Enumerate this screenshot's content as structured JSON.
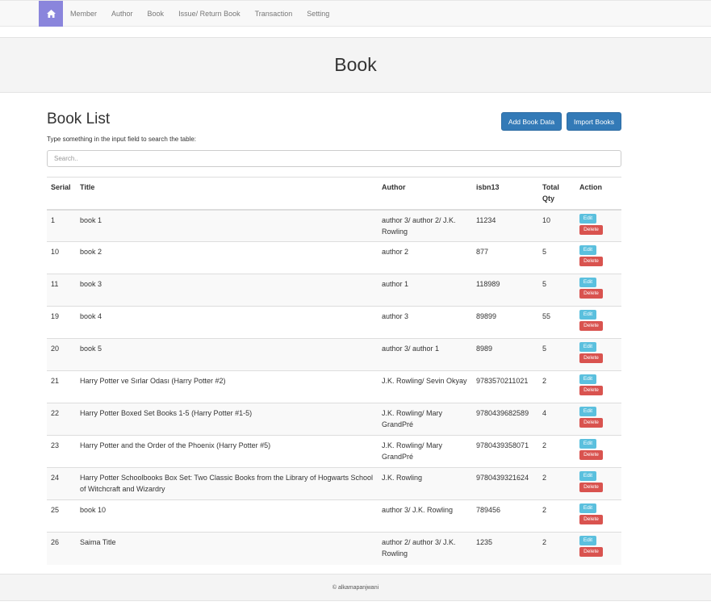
{
  "nav": {
    "home_icon": "home-icon",
    "items": [
      "Member",
      "Author",
      "Book",
      "Issue/ Return Book",
      "Transaction",
      "Setting"
    ]
  },
  "header": {
    "title": "Book"
  },
  "list": {
    "title": "Book List",
    "add_label": "Add Book Data",
    "import_label": "Import Books",
    "hint": "Type something in the input field to search the table:",
    "search_placeholder": "Search.."
  },
  "table": {
    "columns": [
      "Serial",
      "Title",
      "Author",
      "isbn13",
      "Total Qty",
      "Action"
    ],
    "edit_label": "Edit",
    "delete_label": "Delete",
    "rows": [
      {
        "serial": "1",
        "title": "book 1",
        "author": "author 3/ author 2/ J.K. Rowling",
        "isbn": "11234",
        "qty": "10"
      },
      {
        "serial": "10",
        "title": "book 2",
        "author": "author 2",
        "isbn": "877",
        "qty": "5"
      },
      {
        "serial": "11",
        "title": "book 3",
        "author": "author 1",
        "isbn": "118989",
        "qty": "5"
      },
      {
        "serial": "19",
        "title": "book 4",
        "author": "author 3",
        "isbn": "89899",
        "qty": "55"
      },
      {
        "serial": "20",
        "title": "book 5",
        "author": "author 3/ author 1",
        "isbn": "8989",
        "qty": "5"
      },
      {
        "serial": "21",
        "title": "Harry Potter ve Sırlar Odası (Harry Potter #2)",
        "author": "J.K. Rowling/ Sevin Okyay",
        "isbn": "9783570211021",
        "qty": "2"
      },
      {
        "serial": "22",
        "title": "Harry Potter Boxed Set Books 1-5 (Harry Potter #1-5)",
        "author": "J.K. Rowling/ Mary GrandPré",
        "isbn": "9780439682589",
        "qty": "4"
      },
      {
        "serial": "23",
        "title": "Harry Potter and the Order of the Phoenix (Harry Potter #5)",
        "author": "J.K. Rowling/ Mary GrandPré",
        "isbn": "9780439358071",
        "qty": "2"
      },
      {
        "serial": "24",
        "title": "Harry Potter Schoolbooks Box Set: Two Classic Books from the Library of Hogwarts School of Witchcraft and Wizardry",
        "author": "J.K. Rowling",
        "isbn": "9780439321624",
        "qty": "2"
      },
      {
        "serial": "25",
        "title": "book 10",
        "author": "author 3/ J.K. Rowling",
        "isbn": "789456",
        "qty": "2"
      },
      {
        "serial": "26",
        "title": "Saima Title",
        "author": "author 2/ author 3/ J.K. Rowling",
        "isbn": "1235",
        "qty": "2"
      }
    ]
  },
  "footer": {
    "text": "© alkamapanjwani"
  },
  "colors": {
    "primary": "#337ab7",
    "info": "#5bc0de",
    "danger": "#d9534f",
    "home_active": "#8a85dc"
  }
}
